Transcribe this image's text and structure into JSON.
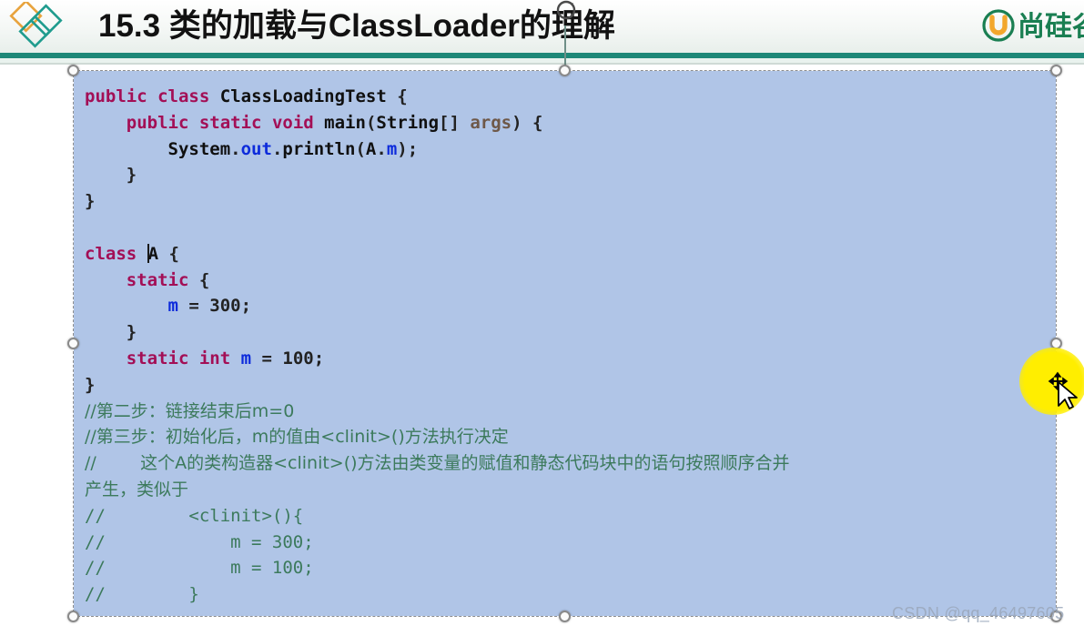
{
  "header": {
    "title": "15.3 类的加载与ClassLoader的理解",
    "logo_left_name": "diamond-logo",
    "brand_text": "尚硅谷",
    "brand_mark_letter": "U",
    "colors": {
      "rule_teal": "#1e8878",
      "title_color": "#121212",
      "brand_green": "#1a7f52",
      "logo_gold": "#e8a33d",
      "logo_teal": "#1f9c8e"
    }
  },
  "code_object": {
    "selected": true,
    "background": "#b0c5e7",
    "caret_visible": true,
    "handles": [
      "top-left",
      "top-center",
      "top-right",
      "middle-left",
      "middle-right",
      "bottom-left",
      "bottom-center",
      "bottom-right"
    ],
    "rotate_handle": true,
    "syntax_colors": {
      "keyword": "#a30f56",
      "identifier": "#101010",
      "field": "#0d2bdb",
      "parameter": "#6e5848",
      "comment": "#3c7a5c",
      "plain": "#1d1d1d"
    },
    "lines": [
      {
        "id": 1,
        "text": "public class ClassLoadingTest {"
      },
      {
        "id": 2,
        "text": "    public static void main(String[] args) {"
      },
      {
        "id": 3,
        "text": "        System.out.println(A.m);"
      },
      {
        "id": 4,
        "text": "    }"
      },
      {
        "id": 5,
        "text": "}"
      },
      {
        "id": 6,
        "text": ""
      },
      {
        "id": 7,
        "text": "class A {"
      },
      {
        "id": 8,
        "text": "    static {"
      },
      {
        "id": 9,
        "text": "        m = 300;"
      },
      {
        "id": 10,
        "text": "    }"
      },
      {
        "id": 11,
        "text": "    static int m = 100;"
      },
      {
        "id": 12,
        "text": "}"
      },
      {
        "id": 13,
        "text": "//第二步：链接结束后m=0"
      },
      {
        "id": 14,
        "text": "//第三步：初始化后，m的值由<clinit>()方法执行决定"
      },
      {
        "id": 15,
        "text": "//        这个A的类构造器<clinit>()方法由类变量的赋值和静态代码块中的语句按照顺序合并"
      },
      {
        "id": 16,
        "text": "产生，类似于"
      },
      {
        "id": 17,
        "text": "//        <clinit>(){"
      },
      {
        "id": 18,
        "text": "//            m = 300;"
      },
      {
        "id": 19,
        "text": "//            m = 100;"
      },
      {
        "id": 20,
        "text": "//        }"
      }
    ]
  },
  "cursor": {
    "type": "move-cursor",
    "spotlight": true,
    "spotlight_color": "#ffee00"
  },
  "watermark": {
    "text": "CSDN @qq_46497605"
  }
}
